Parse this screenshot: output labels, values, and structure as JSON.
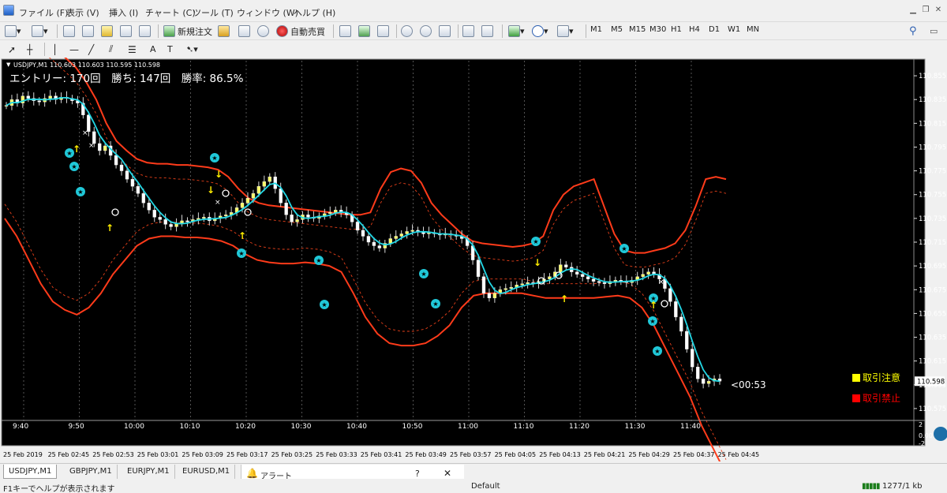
{
  "menu": [
    "ファイル (F)",
    "表示 (V)",
    "挿入 (I)",
    "チャート (C)",
    "ツール (T)",
    "ウィンドウ (W)",
    "ヘルプ (H)"
  ],
  "toolbar": {
    "new_order": "新規注文",
    "auto_trading": "自動売買",
    "text_tool": "A"
  },
  "timeframes": [
    "M1",
    "M5",
    "M15",
    "M30",
    "H1",
    "H4",
    "D1",
    "W1",
    "MN"
  ],
  "chart_data": {
    "type": "candlestick",
    "symbol_header": "USDJPY,M1  110.603 110.603 110.595 110.598",
    "overlay_stats": "エントリー: 170回　勝ち: 147回　勝率: 86.5%",
    "price_axis": [
      "110.855",
      "110.835",
      "110.815",
      "110.795",
      "110.775",
      "110.755",
      "110.735",
      "110.715",
      "110.695",
      "110.675",
      "110.655",
      "110.635",
      "110.615",
      "110.595",
      "110.575"
    ],
    "ylim": [
      110.565,
      110.865
    ],
    "current_price": "110.598",
    "current_price_value": 110.598,
    "countdown": "<00:53",
    "legend": [
      {
        "label": "取引注意",
        "color": "#ffff00"
      },
      {
        "label": "取引禁止",
        "color": "#ff0000"
      }
    ],
    "time_labels_top": [
      "9:40",
      "9:50",
      "10:00",
      "10:10",
      "10:20",
      "10:30",
      "10:40",
      "10:50",
      "11:00",
      "11:10",
      "11:20",
      "11:30",
      "11:40"
    ],
    "time_labels_bottom": [
      "25 Feb 2019",
      "25 Feb 02:45",
      "25 Feb 02:53",
      "25 Feb 03:01",
      "25 Feb 03:09",
      "25 Feb 03:17",
      "25 Feb 03:25",
      "25 Feb 03:33",
      "25 Feb 03:41",
      "25 Feb 03:49",
      "25 Feb 03:57",
      "25 Feb 04:05",
      "25 Feb 04:13",
      "25 Feb 04:21",
      "25 Feb 04:29",
      "25 Feb 04:37",
      "25 Feb 04:45"
    ],
    "subwindow_axis": [
      "2",
      "0.00",
      "-2"
    ],
    "series": [
      {
        "name": "close",
        "values": [
          110.83,
          110.835,
          110.832,
          110.838,
          110.836,
          110.834,
          110.833,
          110.836,
          110.838,
          110.835,
          110.837,
          110.836,
          110.834,
          110.832,
          110.822,
          110.808,
          110.798,
          110.792,
          110.796,
          110.788,
          110.78,
          110.775,
          110.768,
          110.762,
          110.756,
          110.748,
          110.742,
          110.736,
          110.734,
          110.73,
          110.728,
          110.731,
          110.733,
          110.732,
          110.734,
          110.735,
          110.736,
          110.733,
          110.735,
          110.737,
          110.738,
          110.74,
          110.744,
          110.748,
          110.752,
          110.756,
          110.762,
          110.766,
          110.77,
          110.76,
          110.748,
          110.738,
          110.732,
          110.734,
          110.738,
          110.736,
          110.735,
          110.737,
          110.739,
          110.74,
          110.742,
          110.74,
          110.738,
          110.732,
          110.725,
          110.72,
          110.715,
          110.712,
          110.71,
          110.714,
          110.718,
          110.72,
          110.722,
          110.724,
          110.725,
          110.724,
          110.722,
          110.723,
          110.722,
          110.721,
          110.722,
          110.721,
          110.72,
          110.718,
          110.712,
          110.7,
          110.686,
          110.672,
          110.668,
          110.672,
          110.675,
          110.676,
          110.677,
          110.679,
          110.68,
          110.681,
          110.68,
          110.682,
          110.684,
          110.686,
          110.69,
          110.696,
          110.694,
          110.69,
          110.688,
          110.686,
          110.684,
          110.682,
          110.681,
          110.68,
          110.682,
          110.683,
          110.682,
          110.681,
          110.683,
          110.686,
          110.688,
          110.69,
          110.688,
          110.684,
          110.676,
          110.665,
          110.652,
          110.64,
          110.625,
          110.61,
          110.6,
          110.596,
          110.598,
          110.6,
          110.598
        ]
      },
      {
        "name": "upper_band",
        "values": [
          110.905,
          110.9,
          110.895,
          110.89,
          110.885,
          110.878,
          110.87,
          110.862,
          110.85,
          110.835,
          110.815,
          110.8,
          110.792,
          110.785,
          110.782,
          110.781,
          110.781,
          110.78,
          110.78,
          110.779,
          110.778,
          110.776,
          110.77,
          110.76,
          110.752,
          110.748,
          110.746,
          110.745,
          110.744,
          110.743,
          110.742,
          110.741,
          110.74,
          110.739,
          110.738,
          110.738,
          110.74,
          110.76,
          110.774,
          110.777,
          110.775,
          110.765,
          110.748,
          110.738,
          110.73,
          110.722,
          110.716,
          110.714,
          110.713,
          110.712,
          110.711,
          110.712,
          110.714,
          110.72,
          110.742,
          110.755,
          110.762,
          110.765,
          110.768,
          110.745,
          110.722,
          110.708,
          110.706,
          110.706,
          110.708,
          110.71,
          110.714,
          110.725,
          110.745,
          110.768,
          110.77,
          110.768
        ]
      },
      {
        "name": "lower_band",
        "values": [
          110.735,
          110.72,
          110.7,
          110.68,
          110.665,
          110.658,
          110.654,
          110.66,
          110.672,
          110.688,
          110.7,
          110.712,
          110.718,
          110.72,
          110.72,
          110.719,
          110.719,
          110.718,
          110.716,
          110.712,
          110.705,
          110.7,
          110.698,
          110.697,
          110.697,
          110.698,
          110.697,
          110.695,
          110.69,
          110.672,
          110.652,
          110.638,
          110.63,
          110.628,
          110.628,
          110.63,
          110.636,
          110.645,
          110.66,
          110.67,
          110.672,
          110.672,
          110.672,
          110.672,
          110.67,
          110.668,
          110.668,
          110.668,
          110.668,
          110.668,
          110.669,
          110.67,
          110.668,
          110.66,
          110.645,
          110.625,
          110.605,
          110.585,
          110.56,
          110.54,
          110.52
        ]
      }
    ],
    "signals": {
      "up_arrows": 6,
      "down_arrows": 4,
      "stars": 17,
      "crosses": 4,
      "circles": 6
    }
  },
  "tabs": [
    "USDJPY,M1",
    "GBPJPY,M1",
    "EURJPY,M1",
    "EURUSD,M1"
  ],
  "alerts": {
    "title": "アラート"
  },
  "status": {
    "help": "F1キーでヘルプが表示されます",
    "profile": "Default",
    "connection": "1277/1 kb"
  }
}
